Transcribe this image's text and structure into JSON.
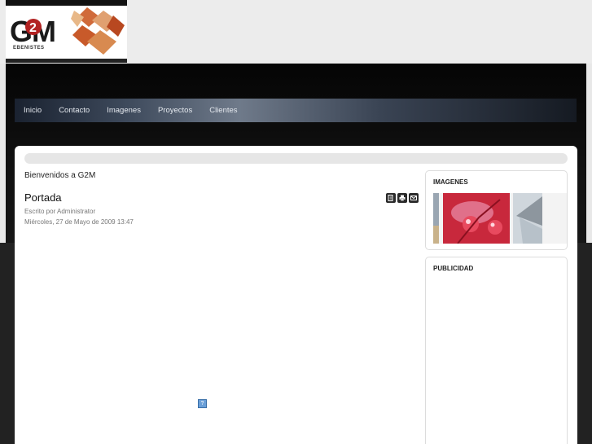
{
  "logo": {
    "text": "G2M",
    "subtitle": "EBENISTES"
  },
  "nav": {
    "items": [
      "Inicio",
      "Contacto",
      "Imagenes",
      "Proyectos",
      "Clientes"
    ]
  },
  "main": {
    "welcome": "Bienvenidos a G2M",
    "article": {
      "title": "Portada",
      "author": "Escrito por Administrator",
      "date": "Miércoles, 27 de Mayo de 2009 13:47"
    }
  },
  "sidebar": {
    "images_title": "IMAGENES",
    "ads_title": "PUBLICIDAD"
  },
  "icons": {
    "pdf": "pdf-icon",
    "print": "print-icon",
    "email": "email-icon",
    "placeholder": "image-placeholder-icon"
  },
  "colors": {
    "accent": "#b22222",
    "nav_text": "#e4e8ee"
  }
}
